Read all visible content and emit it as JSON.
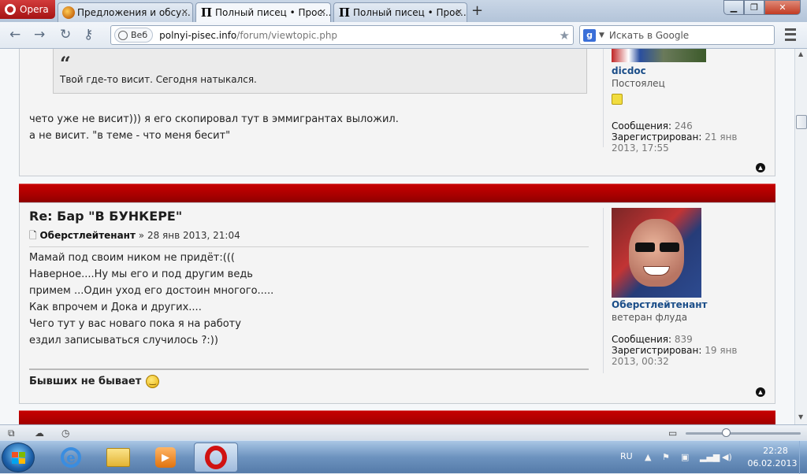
{
  "browser": {
    "menu_label": "Opera",
    "tabs": [
      {
        "label": "Предложения и обсу...",
        "active": false
      },
      {
        "label": "Полный писец • Прос...",
        "active": true
      },
      {
        "label": "Полный писец • Прос...",
        "active": false
      }
    ],
    "favicon_letter": "П",
    "new_tab": "+",
    "address": {
      "chip": "Веб",
      "host": "polnyi-pisec.info",
      "path": "/forum/viewtopic.php"
    },
    "search_placeholder": "Искать в Google",
    "search_engine_letter": "g"
  },
  "post1": {
    "quote_mark": "“",
    "quote_text": "Твой где-то висит. Сегодня натыкался.",
    "lines": [
      "чето уже не висит))) я его скопировал тут в эммигрантах выложил.",
      "а не висит. \"в теме - что меня бесит\""
    ],
    "author": {
      "name": "dicdoc",
      "rank": "Постоялец",
      "messages_label": "Сообщения:",
      "messages": "246",
      "registered_label": "Зарегистрирован:",
      "registered_date": "21 янв",
      "registered_rest": "2013, 17:55"
    }
  },
  "post2": {
    "title": "Re: Бар \"В БУНКЕРЕ\"",
    "author_name": "Оберстлейтенант",
    "date_sep": "»",
    "date": "28 янв 2013, 21:04",
    "lines": [
      "Мамай под своим ником не придёт:(((",
      "Наверное....Ну мы его и под другим ведь",
      "примем ...Один уход его достоин многого.....",
      "Как впрочем и Дока и других....",
      "Чего тут у вас новаго пока я на работу",
      "ездил записываться случилось ?:))"
    ],
    "signature": "Бывших не бывает",
    "profile": {
      "name": "Оберстлейтенант",
      "rank": "ветеран флуда",
      "messages_label": "Сообщения:",
      "messages": "839",
      "registered_label": "Зарегистрирован:",
      "registered_date": "19 янв",
      "registered_rest": "2013, 00:32"
    }
  },
  "taskbar": {
    "language": "RU",
    "time": "22:28",
    "date": "06.02.2013"
  },
  "colors": {
    "red_bar": "#b00000",
    "username": "#1a4d88"
  }
}
